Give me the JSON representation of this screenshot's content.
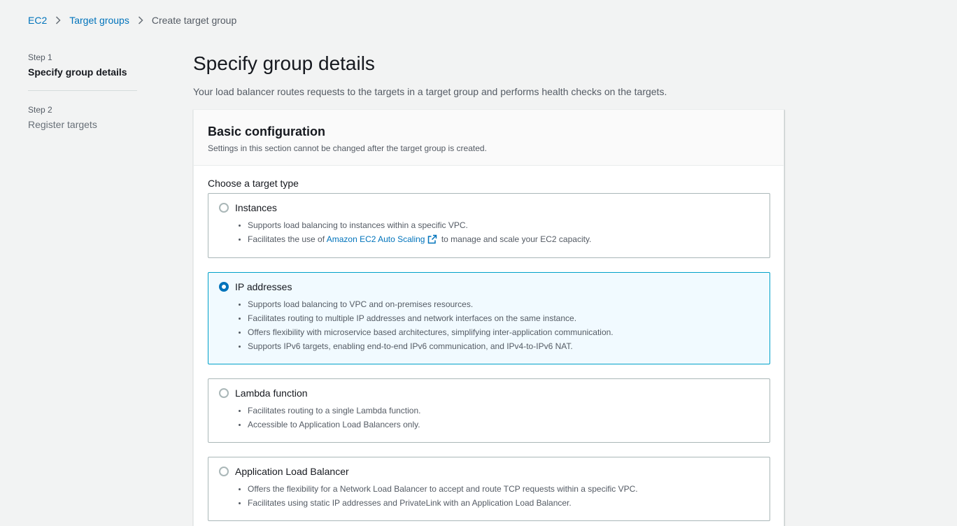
{
  "breadcrumb": {
    "items": [
      "EC2",
      "Target groups"
    ],
    "current": "Create target group"
  },
  "steps": [
    {
      "number": "Step 1",
      "title": "Specify group details"
    },
    {
      "number": "Step 2",
      "title": "Register targets"
    }
  ],
  "page": {
    "title": "Specify group details",
    "description": "Your load balancer routes requests to the targets in a target group and performs health checks on the targets."
  },
  "basic_config": {
    "title": "Basic configuration",
    "subtitle": "Settings in this section cannot be changed after the target group is created.",
    "target_type_label": "Choose a target type"
  },
  "target_types": [
    {
      "label": "Instances",
      "selected": false,
      "bullets": [
        "Supports load balancing to instances within a specific VPC."
      ],
      "link_bullet": {
        "before": "Facilitates the use of ",
        "link": "Amazon EC2 Auto Scaling",
        "after": " to manage and scale your EC2 capacity."
      }
    },
    {
      "label": "IP addresses",
      "selected": true,
      "bullets": [
        "Supports load balancing to VPC and on-premises resources.",
        "Facilitates routing to multiple IP addresses and network interfaces on the same instance.",
        "Offers flexibility with microservice based architectures, simplifying inter-application communication.",
        "Supports IPv6 targets, enabling end-to-end IPv6 communication, and IPv4-to-IPv6 NAT."
      ]
    },
    {
      "label": "Lambda function",
      "selected": false,
      "bullets": [
        "Facilitates routing to a single Lambda function.",
        "Accessible to Application Load Balancers only."
      ]
    },
    {
      "label": "Application Load Balancer",
      "selected": false,
      "bullets": [
        "Offers the flexibility for a Network Load Balancer to accept and route TCP requests within a specific VPC.",
        "Facilitates using static IP addresses and PrivateLink with an Application Load Balancer."
      ]
    }
  ],
  "colors": {
    "link": "#0073bb",
    "selected_bg": "#f1faff",
    "selected_border": "#00a1c9"
  },
  "icons": {
    "breadcrumb_separator": "chevron-right-icon",
    "external_link": "external-link-icon"
  }
}
